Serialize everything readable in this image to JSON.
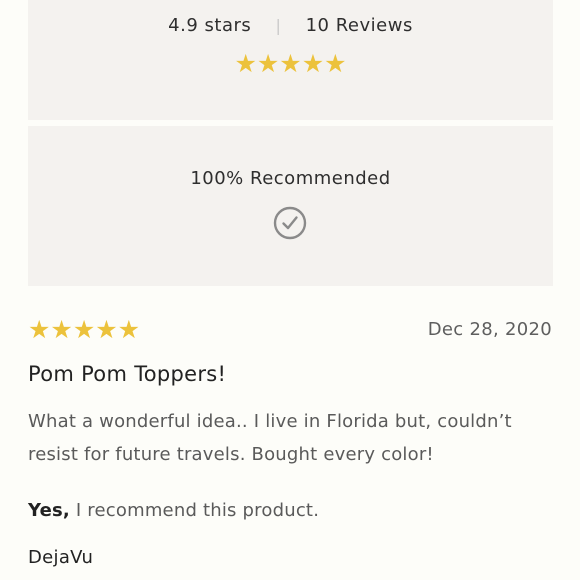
{
  "summary": {
    "rating_text": "4.9 stars",
    "reviews_text": "10 Reviews",
    "rating_stars": 5,
    "stars_glyph": "★★★★★"
  },
  "recommendation": {
    "text": "100% Recommended",
    "icon": "check-circle-icon"
  },
  "review": {
    "rating": 5,
    "stars_glyph": "★★★★★",
    "date": "Dec 28, 2020",
    "title": "Pom Pom Toppers!",
    "body": "What a wonderful idea.. I live in Florida but, couldn’t resist for future travels. Bought every color!",
    "recommend_yes": "Yes,",
    "recommend_text": " I recommend this product.",
    "author": "DejaVu"
  },
  "colors": {
    "star": "#ecc23c",
    "panel_bg": "#f4f2ef",
    "page_bg": "#fdfdf9"
  }
}
